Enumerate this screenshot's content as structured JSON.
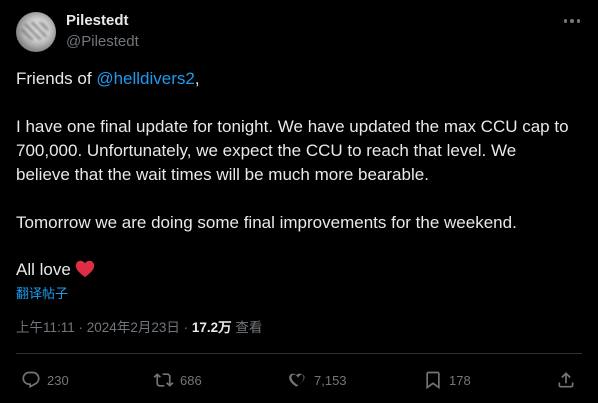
{
  "author": {
    "display_name": "Pilestedt",
    "handle": "@Pilestedt"
  },
  "post": {
    "greeting_prefix": "Friends of ",
    "mention": "@helldivers2",
    "greeting_suffix": ",",
    "lines": [
      "I have one final update for tonight. We have updated the max CCU cap to",
      "700,000. Unfortunately, we expect the CCU to reach that level. We",
      "believe that the wait times will be much more bearable.",
      "Tomorrow we are doing some final improvements for the weekend.",
      "All love"
    ],
    "translate_label": "翻译帖子"
  },
  "meta": {
    "time": "上午11:11",
    "separator": " · ",
    "date": "2024年2月23日",
    "views_count": "17.2万",
    "views_label": "查看"
  },
  "actions": {
    "replies": "230",
    "reposts": "686",
    "likes": "7,153",
    "bookmarks": "178"
  },
  "colors": {
    "background": "#000000",
    "text": "#e7e9ea",
    "secondary": "#71767b",
    "link": "#1d9bf0",
    "heart": "#f91880",
    "divider": "#2f3336"
  },
  "icons": [
    "more-icon",
    "heart-emoji-icon",
    "reply-icon",
    "repost-icon",
    "like-icon",
    "bookmark-icon",
    "share-icon"
  ]
}
